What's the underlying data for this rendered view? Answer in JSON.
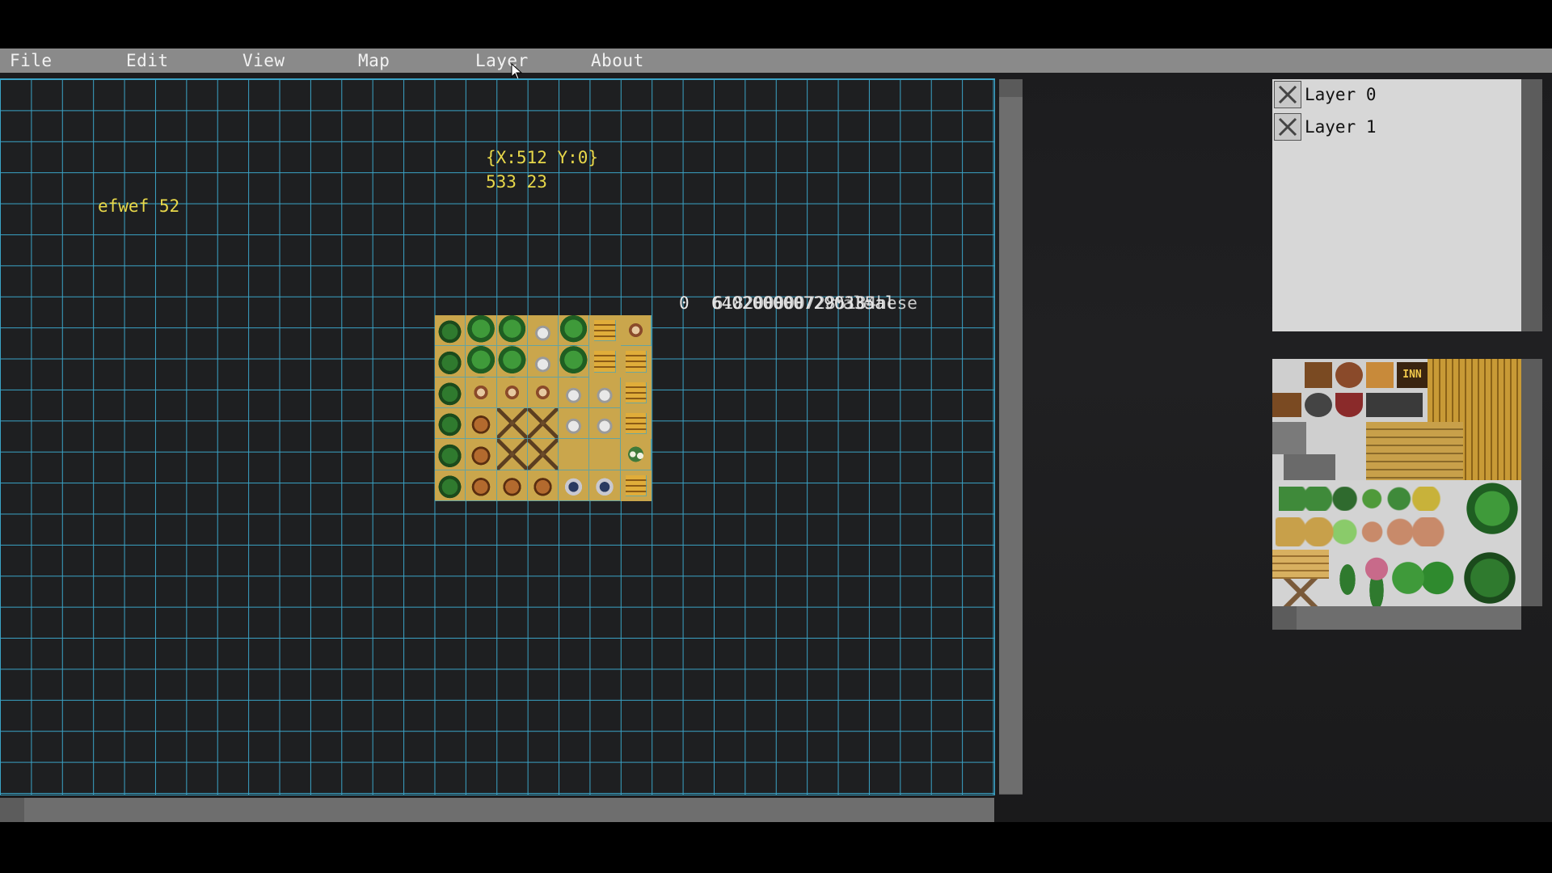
{
  "menu": {
    "items": [
      {
        "label": "File"
      },
      {
        "label": "Edit"
      },
      {
        "label": "View"
      },
      {
        "label": "Map"
      },
      {
        "label": "Layer"
      },
      {
        "label": "About"
      }
    ]
  },
  "canvas": {
    "grid_color": "#3aa3c6",
    "background_color": "#1e1f21",
    "coordinate_readout": "{X:512 Y:0}",
    "cursor_readout": "533 23",
    "debug_label": "efwef 52",
    "overlapped_text_a": "0",
    "overlapped_text_b": "6402000007290335al",
    "overlapped_text_c": "6182000007285184hese",
    "overlapped_text_d": "tale"
  },
  "layers_panel": {
    "layers": [
      {
        "label": "Layer 0",
        "visible_checked": true
      },
      {
        "label": "Layer 1",
        "visible_checked": true
      }
    ]
  },
  "tileset_panel": {
    "sign_text": "INN"
  },
  "colors": {
    "menubar": "#8a8a8a",
    "menu_text": "#f2f2f2",
    "overlay_text": "#e8d84a",
    "panel_bg": "#d7d7d7",
    "scrollbar": "#5c5c5c"
  }
}
